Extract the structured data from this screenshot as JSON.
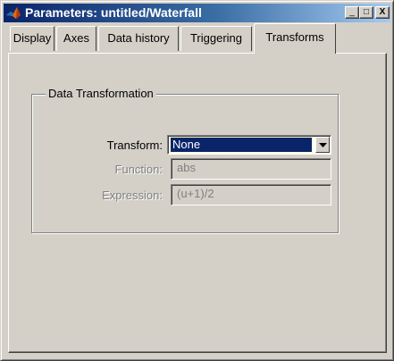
{
  "window": {
    "title": "Parameters: untitled/Waterfall",
    "controls": {
      "minimize": "_",
      "maximize": "□",
      "close": "X"
    }
  },
  "tabs": [
    {
      "label": "Display",
      "active": false
    },
    {
      "label": "Axes",
      "active": false
    },
    {
      "label": "Data history",
      "active": false
    },
    {
      "label": "Triggering",
      "active": false
    },
    {
      "label": "Transforms",
      "active": true
    }
  ],
  "group": {
    "title": "Data Transformation",
    "transform": {
      "label": "Transform:",
      "value": "None"
    },
    "function": {
      "label": "Function:",
      "value": "abs",
      "enabled": false
    },
    "expression": {
      "label": "Expression:",
      "value": "(u+1)/2",
      "enabled": false
    }
  },
  "colors": {
    "face": "#d4d0c8",
    "title_start": "#0a246a",
    "title_end": "#a6caf0",
    "selection": "#0a246a",
    "disabled_text": "#808080"
  },
  "icons": {
    "app": "matlab-icon",
    "dropdown": "chevron-down-icon"
  }
}
